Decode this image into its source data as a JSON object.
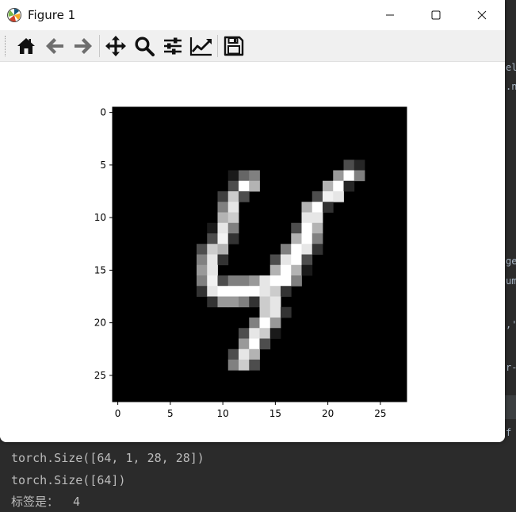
{
  "window": {
    "title": "Figure 1"
  },
  "toolbar": {
    "buttons": [
      {
        "name": "home",
        "icon": "home-icon"
      },
      {
        "name": "back",
        "icon": "arrow-left-icon"
      },
      {
        "name": "forward",
        "icon": "arrow-right-icon"
      },
      {
        "name": "pan",
        "icon": "move-icon"
      },
      {
        "name": "zoom",
        "icon": "magnifier-icon"
      },
      {
        "name": "configure-subplots",
        "icon": "sliders-icon"
      },
      {
        "name": "edit-axes",
        "icon": "line-chart-icon"
      },
      {
        "name": "save",
        "icon": "floppy-disk-icon"
      }
    ]
  },
  "chart_data": {
    "type": "heatmap",
    "colormap": "gray",
    "shape": [
      28,
      28
    ],
    "xlim": [
      -0.5,
      27.5
    ],
    "ylim": [
      27.5,
      -0.5
    ],
    "xticks": [
      0,
      5,
      10,
      15,
      20,
      25
    ],
    "yticks": [
      0,
      5,
      10,
      15,
      20,
      25
    ],
    "pixels": [
      [
        5,
        22,
        0.3
      ],
      [
        5,
        23,
        0.15
      ],
      [
        6,
        11,
        0.1
      ],
      [
        6,
        12,
        0.4
      ],
      [
        6,
        13,
        0.5
      ],
      [
        6,
        21,
        0.6
      ],
      [
        6,
        22,
        1.0
      ],
      [
        6,
        23,
        0.5
      ],
      [
        7,
        11,
        0.3
      ],
      [
        7,
        12,
        1.0
      ],
      [
        7,
        13,
        0.7
      ],
      [
        7,
        20,
        0.7
      ],
      [
        7,
        21,
        1.0
      ],
      [
        7,
        22,
        0.15
      ],
      [
        8,
        10,
        0.25
      ],
      [
        8,
        11,
        0.8
      ],
      [
        8,
        12,
        0.3
      ],
      [
        8,
        19,
        0.3
      ],
      [
        8,
        20,
        0.95
      ],
      [
        8,
        21,
        0.9
      ],
      [
        9,
        10,
        0.5
      ],
      [
        9,
        11,
        0.9
      ],
      [
        9,
        18,
        0.7
      ],
      [
        9,
        19,
        1.0
      ],
      [
        9,
        20,
        0.2
      ],
      [
        10,
        10,
        0.7
      ],
      [
        10,
        11,
        0.8
      ],
      [
        10,
        18,
        0.9
      ],
      [
        10,
        19,
        0.9
      ],
      [
        11,
        9,
        0.1
      ],
      [
        11,
        10,
        0.9
      ],
      [
        11,
        11,
        0.5
      ],
      [
        11,
        17,
        0.3
      ],
      [
        11,
        18,
        1.0
      ],
      [
        11,
        19,
        0.7
      ],
      [
        12,
        9,
        0.3
      ],
      [
        12,
        10,
        0.95
      ],
      [
        12,
        11,
        0.2
      ],
      [
        12,
        17,
        0.7
      ],
      [
        12,
        18,
        1.0
      ],
      [
        12,
        19,
        0.5
      ],
      [
        13,
        8,
        0.3
      ],
      [
        13,
        9,
        0.8
      ],
      [
        13,
        10,
        0.7
      ],
      [
        13,
        16,
        0.5
      ],
      [
        13,
        17,
        1.0
      ],
      [
        13,
        18,
        0.9
      ],
      [
        13,
        19,
        0.2
      ],
      [
        14,
        8,
        0.5
      ],
      [
        14,
        9,
        0.9
      ],
      [
        14,
        10,
        0.2
      ],
      [
        14,
        15,
        0.3
      ],
      [
        14,
        16,
        0.9
      ],
      [
        14,
        17,
        1.0
      ],
      [
        14,
        18,
        0.3
      ],
      [
        15,
        8,
        0.6
      ],
      [
        15,
        9,
        0.9
      ],
      [
        15,
        15,
        0.7
      ],
      [
        15,
        16,
        1.0
      ],
      [
        15,
        17,
        0.7
      ],
      [
        15,
        18,
        0.1
      ],
      [
        16,
        8,
        0.5
      ],
      [
        16,
        9,
        0.95
      ],
      [
        16,
        10,
        0.3
      ],
      [
        16,
        11,
        0.5
      ],
      [
        16,
        12,
        0.5
      ],
      [
        16,
        13,
        0.6
      ],
      [
        16,
        14,
        0.9
      ],
      [
        16,
        15,
        1.0
      ],
      [
        16,
        16,
        1.0
      ],
      [
        16,
        17,
        0.5
      ],
      [
        17,
        8,
        0.2
      ],
      [
        17,
        9,
        0.9
      ],
      [
        17,
        10,
        1.0
      ],
      [
        17,
        11,
        1.0
      ],
      [
        17,
        12,
        1.0
      ],
      [
        17,
        13,
        1.0
      ],
      [
        17,
        14,
        0.9
      ],
      [
        17,
        15,
        0.8
      ],
      [
        17,
        16,
        0.2
      ],
      [
        18,
        9,
        0.2
      ],
      [
        18,
        10,
        0.6
      ],
      [
        18,
        11,
        0.6
      ],
      [
        18,
        12,
        0.5
      ],
      [
        18,
        13,
        0.2
      ],
      [
        18,
        14,
        0.8
      ],
      [
        18,
        15,
        0.9
      ],
      [
        19,
        14,
        0.8
      ],
      [
        19,
        15,
        0.9
      ],
      [
        19,
        16,
        0.2
      ],
      [
        20,
        13,
        0.5
      ],
      [
        20,
        14,
        1.0
      ],
      [
        20,
        15,
        0.6
      ],
      [
        21,
        12,
        0.3
      ],
      [
        21,
        13,
        0.9
      ],
      [
        21,
        14,
        0.8
      ],
      [
        21,
        15,
        0.1
      ],
      [
        22,
        12,
        0.6
      ],
      [
        22,
        13,
        1.0
      ],
      [
        22,
        14,
        0.3
      ],
      [
        23,
        11,
        0.3
      ],
      [
        23,
        12,
        0.9
      ],
      [
        23,
        13,
        0.7
      ],
      [
        24,
        11,
        0.5
      ],
      [
        24,
        12,
        0.8
      ],
      [
        24,
        13,
        0.3
      ]
    ]
  },
  "console": {
    "lines": [
      "torch.Size([64, 1, 28, 28])",
      "torch.Size([64])",
      "标签是：  4"
    ]
  },
  "ide_background": {
    "fragments": [
      "el",
      ".n",
      "ge",
      "um",
      ",'",
      "r-",
      "f"
    ]
  }
}
